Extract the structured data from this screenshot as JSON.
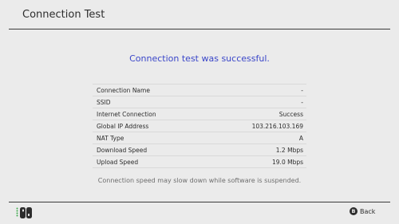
{
  "header": {
    "title": "Connection Test"
  },
  "status": {
    "message": "Connection test was successful."
  },
  "results": [
    {
      "label": "Connection Name",
      "value": "-"
    },
    {
      "label": "SSID",
      "value": "-"
    },
    {
      "label": "Internet Connection",
      "value": "Success"
    },
    {
      "label": "Global IP Address",
      "value": "103.216.103.169"
    },
    {
      "label": "NAT Type",
      "value": "A"
    },
    {
      "label": "Download Speed",
      "value": "1.2 Mbps"
    },
    {
      "label": "Upload Speed",
      "value": "19.0 Mbps"
    }
  ],
  "note": "Connection speed may slow down while software is suspended.",
  "footer": {
    "back_button_glyph": "B",
    "back_label": "Back",
    "controller_icon": "joycon-pair-icon"
  },
  "colors": {
    "background": "#ebebeb",
    "accent_text": "#3a46c9",
    "joycon_left": "#2ec4e0",
    "joycon_right": "#ef3d3d"
  }
}
